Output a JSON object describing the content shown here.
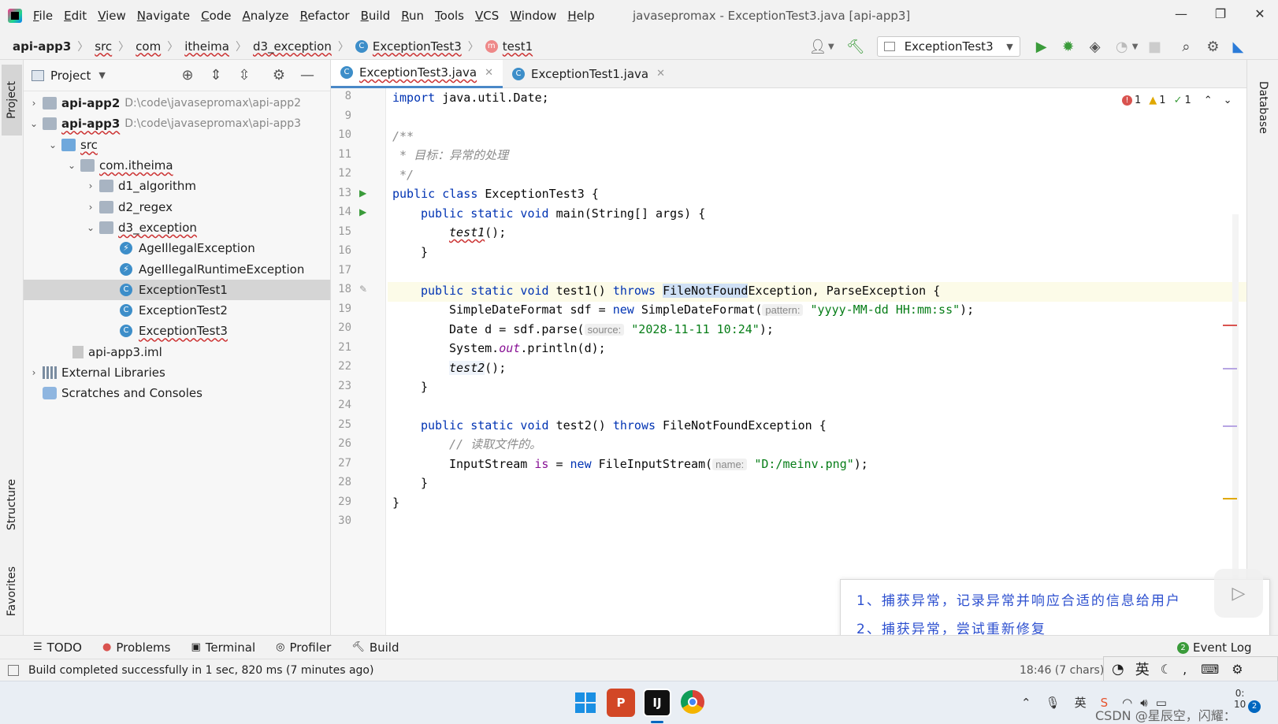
{
  "menubar": {
    "items": [
      "File",
      "Edit",
      "View",
      "Navigate",
      "Code",
      "Analyze",
      "Refactor",
      "Build",
      "Run",
      "Tools",
      "VCS",
      "Window",
      "Help"
    ],
    "window_title": "javasepromax - ExceptionTest3.java [api-app3]"
  },
  "navbar": {
    "breadcrumbs": [
      "api-app3",
      "src",
      "com",
      "itheima",
      "d3_exception",
      "ExceptionTest3",
      "test1"
    ],
    "run_config": "ExceptionTest3"
  },
  "left_stripe": {
    "project": "Project",
    "structure": "Structure",
    "favorites": "Favorites"
  },
  "right_stripe": {
    "database": "Database"
  },
  "project_panel": {
    "title": "Project",
    "tree": [
      {
        "label": "api-app2",
        "path": "D:\\code\\javasepromax\\api-app2"
      },
      {
        "label": "api-app3",
        "path": "D:\\code\\javasepromax\\api-app3"
      },
      {
        "label": "src"
      },
      {
        "label": "com.itheima"
      },
      {
        "label": "d1_algorithm"
      },
      {
        "label": "d2_regex"
      },
      {
        "label": "d3_exception"
      },
      {
        "label": "AgeIllegalException"
      },
      {
        "label": "AgeIllegalRuntimeException"
      },
      {
        "label": "ExceptionTest1"
      },
      {
        "label": "ExceptionTest2"
      },
      {
        "label": "ExceptionTest3"
      },
      {
        "label": "api-app3.iml"
      },
      {
        "label": "External Libraries"
      },
      {
        "label": "Scratches and Consoles"
      }
    ]
  },
  "editor": {
    "tabs": [
      {
        "label": "ExceptionTest3.java",
        "active": true
      },
      {
        "label": "ExceptionTest1.java",
        "active": false
      }
    ],
    "inspections": {
      "errors": "1",
      "warnings": "1",
      "weak": "1"
    },
    "line_numbers": [
      "8",
      "9",
      "10",
      "11",
      "12",
      "13",
      "14",
      "15",
      "16",
      "17",
      "18",
      "19",
      "20",
      "21",
      "22",
      "23",
      "24",
      "25",
      "26",
      "27",
      "28",
      "29",
      "30"
    ],
    "code": {
      "l8": {
        "kw": "import",
        "rest": " java.util.Date;"
      },
      "l10": "/**",
      "l11": " * 目标：异常的处理",
      "l12": " */",
      "l13": {
        "kw": "public class",
        "rest": " ExceptionTest3 {"
      },
      "l14": {
        "kw": "public static void",
        "rest": " main(String[] args) {"
      },
      "l15": {
        "call": "test1",
        "rest": "();"
      },
      "l16": "}",
      "l18": {
        "kw": "public static void",
        "name": " test1() ",
        "throws": "throws",
        "hl": "FileNotFound",
        "rest": "Exception, ParseException {"
      },
      "l19": {
        "a": "SimpleDateFormat sdf = ",
        "kw": "new",
        "b": " SimpleDateFormat(",
        "hint": "pattern:",
        "str": "\"yyyy-MM-dd HH:mm:ss\"",
        "c": ");"
      },
      "l20": {
        "a": "Date d = sdf.parse(",
        "hint": "source:",
        "str": "\"2028-11-11 10:24\"",
        "c": ");"
      },
      "l21": {
        "a": "System.",
        "fld": "out",
        "c": ".println(d);"
      },
      "l22": {
        "call": "test2",
        "rest": "();"
      },
      "l23": "}",
      "l25": {
        "kw": "public static void",
        "name": " test2() ",
        "throws": "throws",
        "rest": " FileNotFoundException {"
      },
      "l26": "// 读取文件的。",
      "l27": {
        "a": "InputStream ",
        "is": "is",
        "b": " = ",
        "kw": "new",
        "c": " FileInputStream(",
        "hint": "name:",
        "str": "\"D:/meinv.png\"",
        "d": ");"
      },
      "l28": "}",
      "l29": "}"
    }
  },
  "bottom_toolbar": {
    "items": [
      "TODO",
      "Problems",
      "Terminal",
      "Profiler",
      "Build"
    ],
    "event_log": "Event Log",
    "event_count": "2"
  },
  "statusbar": {
    "message": "Build completed successfully in 1 sec, 820 ms (7 minutes ago)",
    "position": "18:46 (7 chars)",
    "ime": "英"
  },
  "note": {
    "line1": "1、捕获异常，记录异常并响应合适的信息给用户",
    "line2": "2、捕获异常，尝试重新修复"
  },
  "taskbar": {
    "time": "0:",
    "date": "10",
    "watermark": "CSDN @星辰空，闪耀："
  },
  "colors": {
    "keyword": "#0033b3",
    "string": "#067d17",
    "comment": "#8c8c8c",
    "accent": "#4a88c7",
    "note_text": "#2c4fcf"
  }
}
